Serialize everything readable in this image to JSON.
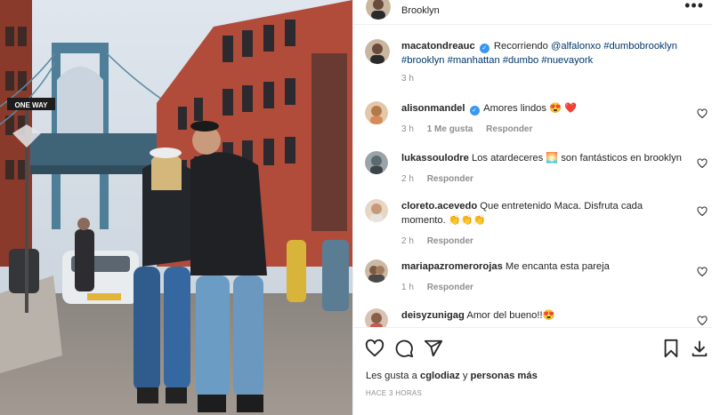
{
  "header": {
    "location": "Brooklyn",
    "more_glyph": "•••"
  },
  "caption": {
    "username": "macatondreauc",
    "verified": true,
    "line1": "Recorriendo",
    "mention": "@alfalonxo",
    "tag1": "#dumbobrooklyn",
    "tags2": [
      "#brooklyn",
      "#manhattan",
      "#dumbo",
      "#nuevayork"
    ],
    "time": "3 h"
  },
  "comments": [
    {
      "username": "alisonmandel",
      "verified": true,
      "text": "Amores lindos 😍 ❤️",
      "time": "3 h",
      "likes": "1 Me gusta",
      "reply": "Responder"
    },
    {
      "username": "lukassoulodre",
      "verified": false,
      "text": "Los atardeceres 🌅 son fantásticos en brooklyn",
      "time": "2 h",
      "reply": "Responder"
    },
    {
      "username": "cloreto.acevedo",
      "verified": false,
      "text": "Que entretenido Maca. Disfruta cada momento. 👏👏👏",
      "time": "2 h",
      "reply": "Responder"
    },
    {
      "username": "mariapazromerorojas",
      "verified": false,
      "text": "Me encanta esta pareja",
      "time": "1 h",
      "reply": "Responder"
    },
    {
      "username": "deisyzunigag",
      "verified": false,
      "text": "Amor del bueno!!😍",
      "time": "",
      "reply": ""
    }
  ],
  "footer": {
    "likes_prefix": "Les gusta a",
    "likes_user": "cglodiaz",
    "likes_and": "y",
    "likes_others": "personas más",
    "posted": "HACE 3 HORAS"
  },
  "icons": {
    "verified": "verified-badge-icon",
    "heart": "heart-outline-icon",
    "comment": "comment-icon",
    "share": "share-icon",
    "save": "bookmark-icon"
  },
  "photo": {
    "street_sign": "ONE WAY"
  }
}
